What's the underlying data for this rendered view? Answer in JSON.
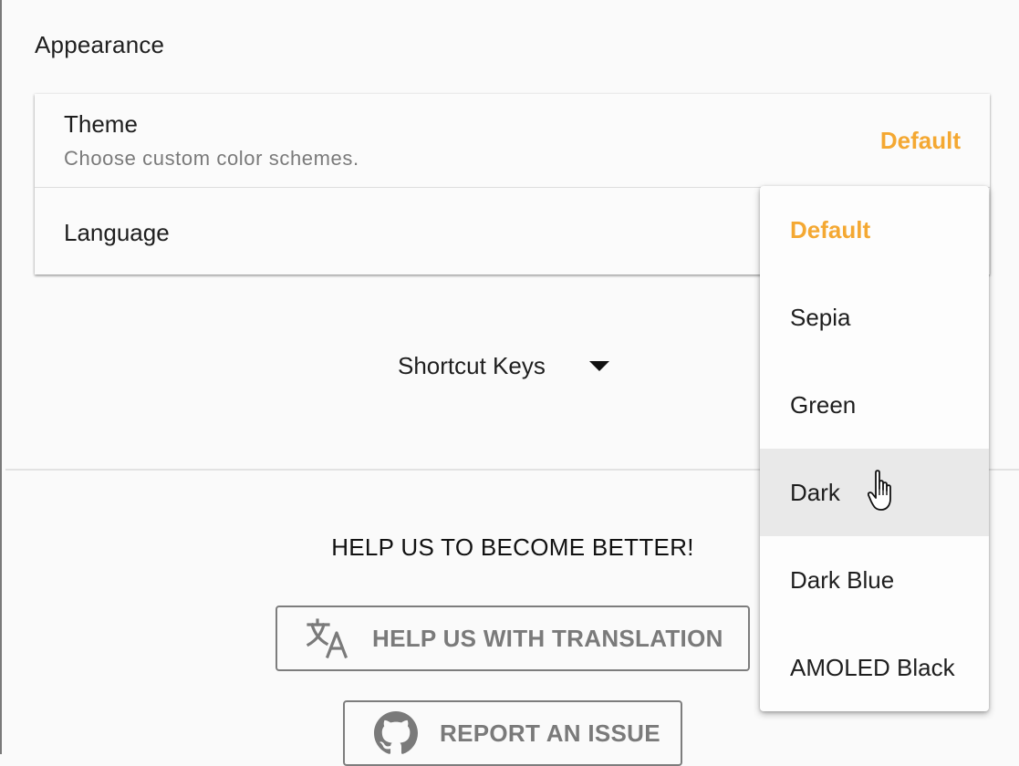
{
  "appearance": {
    "title": "Appearance",
    "theme": {
      "label": "Theme",
      "description": "Choose custom color schemes.",
      "value": "Default"
    },
    "language": {
      "label": "Language"
    }
  },
  "shortcut_keys": {
    "label": "Shortcut Keys",
    "icon": "caret-down-icon"
  },
  "help": {
    "heading": "HELP US TO BECOME BETTER!",
    "translate_button": {
      "label": "HELP US WITH TRANSLATION",
      "icon": "translate-icon"
    },
    "report_button": {
      "label": "REPORT AN ISSUE",
      "icon": "github-icon"
    }
  },
  "theme_menu": {
    "selected": "Default",
    "hovered": "Dark",
    "options": [
      "Default",
      "Sepia",
      "Green",
      "Dark",
      "Dark Blue",
      "AMOLED Black"
    ]
  },
  "colors": {
    "accent": "#f4a832",
    "background": "#fafafa",
    "hover": "#e9e9e9",
    "muted_text": "#7a7a7a"
  }
}
